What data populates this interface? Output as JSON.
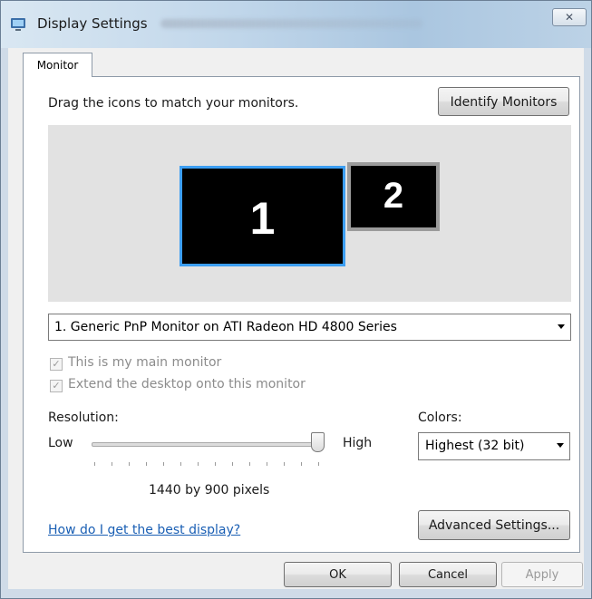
{
  "window": {
    "title": "Display Settings",
    "close_label": "✕"
  },
  "tabs": [
    {
      "label": "Monitor"
    }
  ],
  "arrangement": {
    "instruction": "Drag the icons to match your monitors.",
    "identify_button": "Identify Monitors",
    "monitors": [
      {
        "label": "1",
        "selected": true
      },
      {
        "label": "2",
        "selected": false
      }
    ]
  },
  "monitor_select": {
    "value": "1. Generic PnP Monitor on ATI Radeon HD 4800 Series"
  },
  "checkboxes": [
    {
      "label": "This is my main monitor",
      "checked": true,
      "enabled": false
    },
    {
      "label": "Extend the desktop onto this monitor",
      "checked": true,
      "enabled": false
    }
  ],
  "resolution": {
    "label": "Resolution:",
    "low_label": "Low",
    "high_label": "High",
    "value_text": "1440 by 900 pixels",
    "slider_level": 1.0
  },
  "colors": {
    "label": "Colors:",
    "value": "Highest (32 bit)"
  },
  "help_link": "How do I get the best display?",
  "advanced_button": "Advanced Settings...",
  "footer": {
    "ok": "OK",
    "cancel": "Cancel",
    "apply": "Apply"
  },
  "colors_theme": {
    "selection": "#3c9ef2",
    "link": "#1a5fb4",
    "monitor_bg": "#000000"
  }
}
